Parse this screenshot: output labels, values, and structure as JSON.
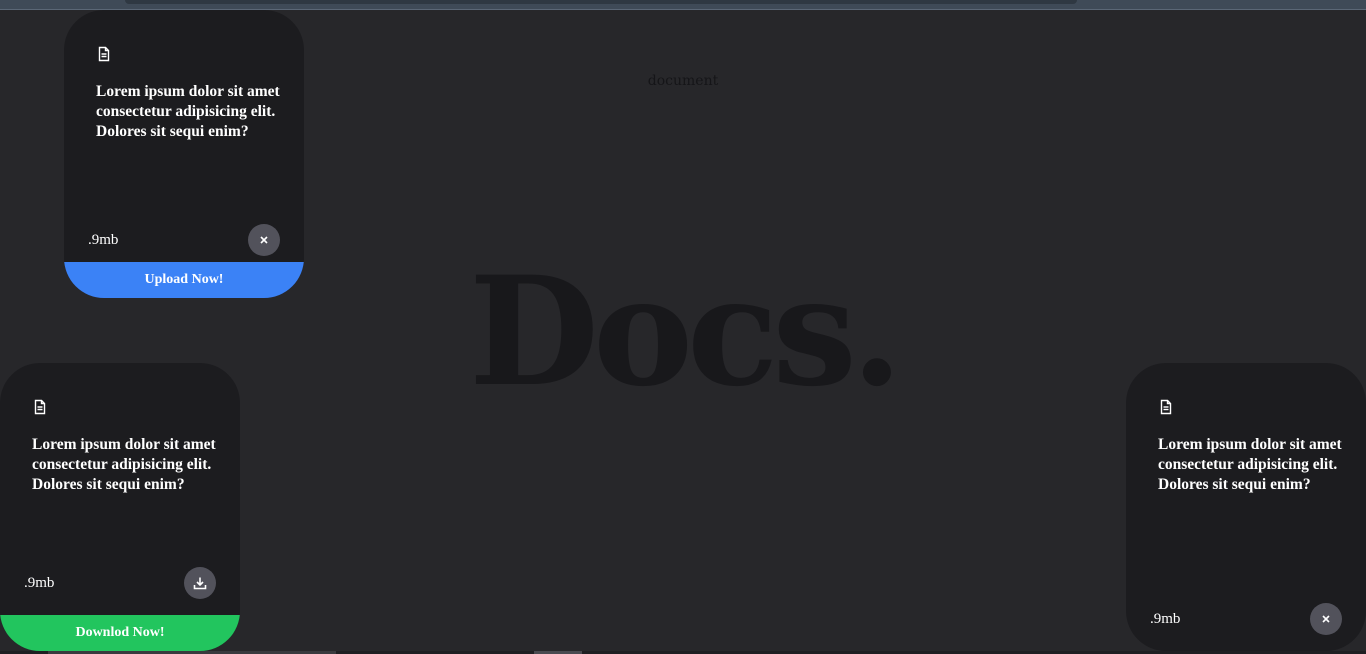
{
  "page": {
    "heading": "document",
    "hero": "Docs."
  },
  "cards": [
    {
      "icon": "document-icon",
      "title": "Lorem ipsum dolor sit amet consectetur adipisicing elit. Dolores sit sequi enim?",
      "size": ".9mb",
      "button_icon": "close-icon",
      "action_label": "Upload Now!",
      "action_color": "#3b82f6"
    },
    {
      "icon": "document-icon",
      "title": "Lorem ipsum dolor sit amet consectetur adipisicing elit. Dolores sit sequi enim?",
      "size": ".9mb",
      "button_icon": "download-icon",
      "action_label": "Downlod Now!",
      "action_color": "#22c55e"
    },
    {
      "icon": "document-icon",
      "title": "Lorem ipsum dolor sit amet consectetur adipisicing elit. Dolores sit sequi enim?",
      "size": ".9mb",
      "button_icon": "close-icon"
    }
  ],
  "colors": {
    "background": "#27272a",
    "card": "#1c1c1f",
    "round_button": "#52525b"
  }
}
